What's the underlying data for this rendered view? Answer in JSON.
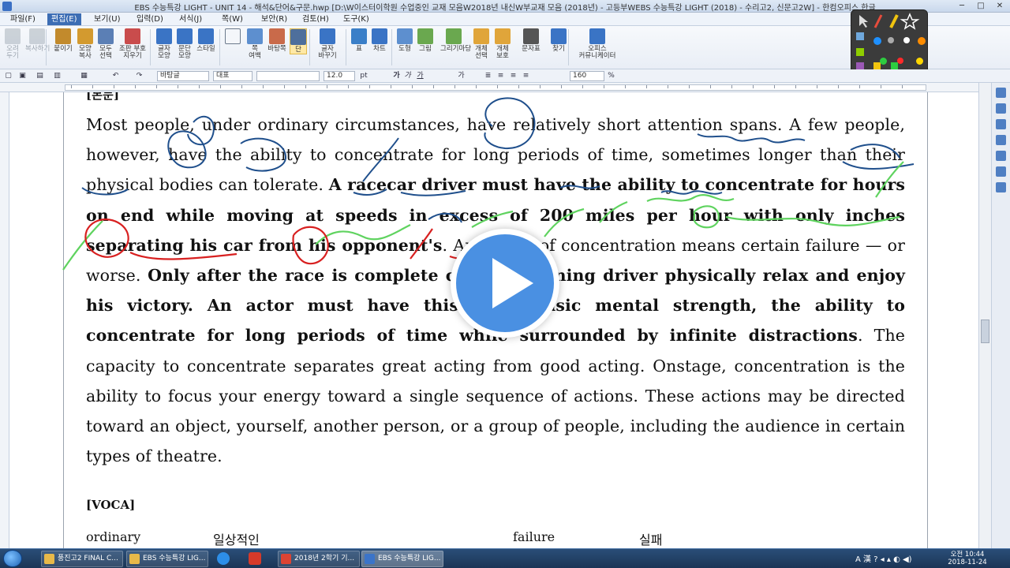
{
  "window": {
    "title": "EBS 수능특강 LIGHT - UNIT 14 - 해석&단어&구문.hwp [D:\\W이스터이학원 수업중인 교재 모음W2018년 내신W부교재 모음 (2018년) - 고등부WEBS 수능특강 LIGHT (2018) - 수리고2, 신문고2W] - 한컴오피스 한글",
    "minimize": "─",
    "maximize": "□",
    "close": "✕"
  },
  "menu": [
    "파일(F)",
    "편집(E)",
    "보기(U)",
    "입력(D)",
    "서식(J)",
    "쪽(W)",
    "보안(R)",
    "검토(H)",
    "도구(K)"
  ],
  "menu_active_index": 1,
  "ribbon": [
    {
      "label": "오려\n두기",
      "icon": "scissors-icon",
      "disabled": true
    },
    {
      "label": "복사하기",
      "icon": "copy-icon",
      "disabled": true
    },
    {
      "label": "붙이기",
      "icon": "paste-icon"
    },
    {
      "label": "모양\n복사",
      "icon": "format-painter-icon"
    },
    {
      "label": "모두\n선택",
      "icon": "select-all-icon"
    },
    {
      "label": "조판 부호\n지우기",
      "icon": "clear-codes-icon"
    },
    {
      "label": "글자\n모양",
      "icon": "char-shape-icon"
    },
    {
      "label": "문단\n모양",
      "icon": "paragraph-shape-icon"
    },
    {
      "label": "스타일",
      "icon": "style-icon"
    },
    {
      "label": "",
      "icon": "page-icon"
    },
    {
      "label": "쪽\n여백",
      "icon": "margin-icon"
    },
    {
      "label": "바탕쪽",
      "icon": "master-page-icon"
    },
    {
      "label": "단",
      "icon": "columns-icon",
      "selected": true
    },
    {
      "label": "글자\n바꾸기",
      "icon": "replace-char-icon"
    },
    {
      "label": "표",
      "icon": "table-icon"
    },
    {
      "label": "차트",
      "icon": "chart-icon"
    },
    {
      "label": "도형",
      "icon": "shape-icon"
    },
    {
      "label": "그림",
      "icon": "picture-icon"
    },
    {
      "label": "그리기마당",
      "icon": "clipart-icon"
    },
    {
      "label": "개체\n선택",
      "icon": "object-select-icon"
    },
    {
      "label": "개체\n보호",
      "icon": "object-protect-icon"
    },
    {
      "label": "문자표",
      "icon": "symbol-icon"
    },
    {
      "label": "찾기",
      "icon": "find-icon"
    },
    {
      "label": "오피스\n커뮤니케이터",
      "icon": "communicator-icon"
    }
  ],
  "format_bar": {
    "style": "바탕글",
    "lang": "대표",
    "font": "",
    "size": "12.0",
    "size_unit": "pt",
    "zoom": "160",
    "zoom_unit": "%"
  },
  "document": {
    "partial_heading": "[본문]",
    "paragraph": [
      {
        "text": "Most people, under ordinary circumstances, have relatively short attention spans. A few people, however, have the ability to concentrate for long periods of time, sometimes longer than their physical bodies can tolerate. ",
        "bold": false
      },
      {
        "text": "A racecar driver must have the ability to concentrate for hours on end while moving at speeds in excess of 200 miles per hour with only inches separating his car from his opponent's",
        "bold": true
      },
      {
        "text": ". Any lapse of concentration means certain failure — or worse. ",
        "bold": false
      },
      {
        "text": "Only after the race is complete can the winning driver physically relax and enjoy his victory. An actor must have this same basic mental strength, the ability to concentrate for long periods of time while surrounded by infinite distractions",
        "bold": true
      },
      {
        "text": ". The capacity to concentrate separates great acting from good acting. Onstage, concentration is the ability to focus your energy toward a single sequence of actions. These actions may be directed toward an object, yourself, another person, or a group of people, including the audience in certain types of theatre.",
        "bold": false
      }
    ],
    "voca_heading": "[VOCA]",
    "voca": [
      {
        "word": "ordinary",
        "meaning": "일상적인"
      },
      {
        "word": "failure",
        "meaning": "실패"
      }
    ]
  },
  "annotation_colors": {
    "blue": "#1f4f8c",
    "green": "#5fd35f",
    "red": "#d82020"
  },
  "pen_palette_colors": [
    "#ff2a2a",
    "#2ecc40",
    "#1e90ff",
    "#ffffff",
    "#ffd700",
    "#ff8c00",
    "#aaaaaa"
  ],
  "taskbar": {
    "tasks": [
      {
        "label": "풍진고2 FINAL C...",
        "icon_color": "#e8b949"
      },
      {
        "label": "EBS 수능특강 LIG...",
        "icon_color": "#e8b949"
      },
      {
        "label": "2018년 2학기 기...",
        "icon_color": "#dd4433"
      },
      {
        "label": "EBS 수능특강 LIG...",
        "icon_color": "#3b74c9",
        "active": true
      }
    ],
    "tray": "A 漢 ? ◂ ▴ ◐ ◀)",
    "time": "오전 10:44",
    "date": "2018-11-24"
  }
}
